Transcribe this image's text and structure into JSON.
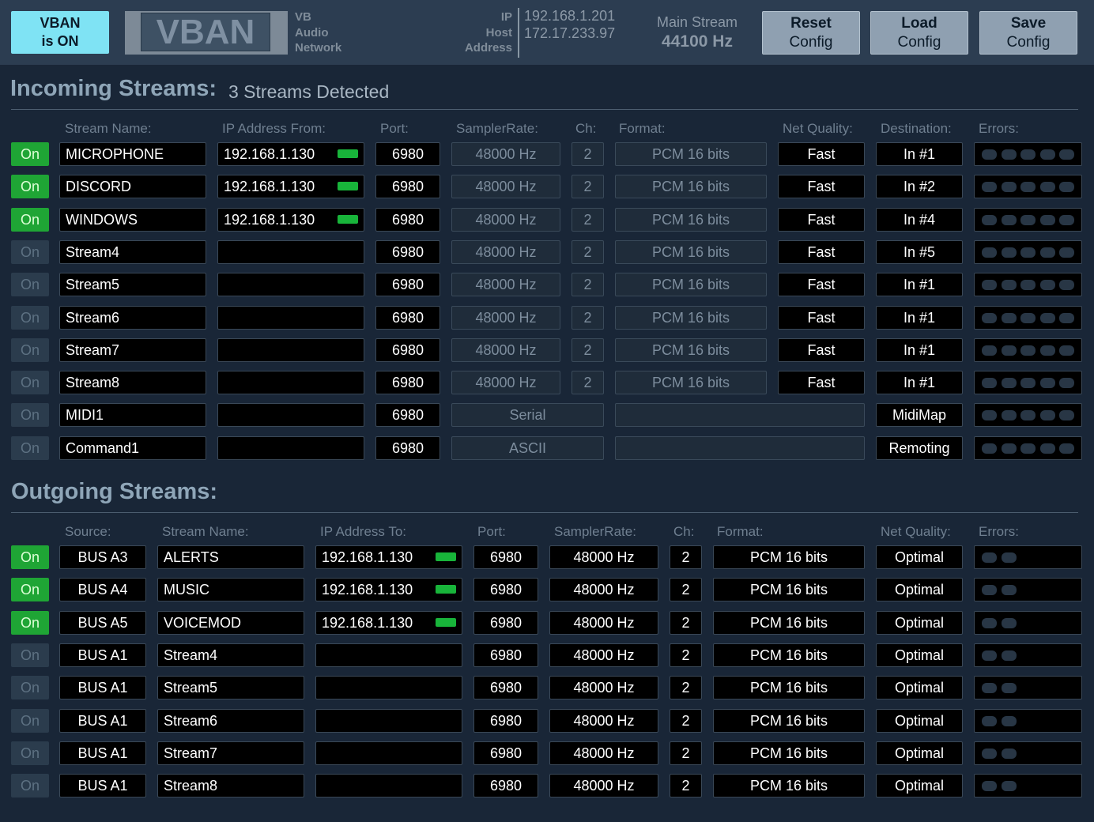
{
  "header": {
    "vban_status": [
      "VBAN",
      "is ON"
    ],
    "logo": "VBAN",
    "vb_lines": [
      "VB",
      "Audio",
      "Network"
    ],
    "ip_labels": [
      "IP",
      "Host",
      "Address"
    ],
    "ip_values": [
      "192.168.1.201",
      "172.17.233.97"
    ],
    "main_stream_label": "Main Stream",
    "main_stream_value": "44100 Hz",
    "buttons": [
      {
        "line1": "Reset",
        "line2": "Config"
      },
      {
        "line1": "Load",
        "line2": "Config"
      },
      {
        "line1": "Save",
        "line2": "Config"
      }
    ]
  },
  "incoming": {
    "title": "Incoming Streams:",
    "subtitle": "3 Streams Detected",
    "columns": [
      "Stream Name:",
      "IP Address From:",
      "Port:",
      "SamplerRate:",
      "Ch:",
      "Format:",
      "Net Quality:",
      "Destination:",
      "Errors:"
    ],
    "rows": [
      {
        "on": "On",
        "active": true,
        "name": "MICROPHONE",
        "ip": "192.168.1.130",
        "led": true,
        "port": "6980",
        "rate": "48000 Hz",
        "ch": "2",
        "format": "PCM 16 bits",
        "quality": "Fast",
        "dest": "In #1"
      },
      {
        "on": "On",
        "active": true,
        "name": "DISCORD",
        "ip": "192.168.1.130",
        "led": true,
        "port": "6980",
        "rate": "48000 Hz",
        "ch": "2",
        "format": "PCM 16 bits",
        "quality": "Fast",
        "dest": "In #2"
      },
      {
        "on": "On",
        "active": true,
        "name": "WINDOWS",
        "ip": "192.168.1.130",
        "led": true,
        "port": "6980",
        "rate": "48000 Hz",
        "ch": "2",
        "format": "PCM 16 bits",
        "quality": "Fast",
        "dest": "In #4"
      },
      {
        "on": "On",
        "active": false,
        "name": "Stream4",
        "ip": "",
        "led": false,
        "port": "6980",
        "rate": "48000 Hz",
        "ch": "2",
        "format": "PCM 16 bits",
        "quality": "Fast",
        "dest": "In #5"
      },
      {
        "on": "On",
        "active": false,
        "name": "Stream5",
        "ip": "",
        "led": false,
        "port": "6980",
        "rate": "48000 Hz",
        "ch": "2",
        "format": "PCM 16 bits",
        "quality": "Fast",
        "dest": "In #1"
      },
      {
        "on": "On",
        "active": false,
        "name": "Stream6",
        "ip": "",
        "led": false,
        "port": "6980",
        "rate": "48000 Hz",
        "ch": "2",
        "format": "PCM 16 bits",
        "quality": "Fast",
        "dest": "In #1"
      },
      {
        "on": "On",
        "active": false,
        "name": "Stream7",
        "ip": "",
        "led": false,
        "port": "6980",
        "rate": "48000 Hz",
        "ch": "2",
        "format": "PCM 16 bits",
        "quality": "Fast",
        "dest": "In #1"
      },
      {
        "on": "On",
        "active": false,
        "name": "Stream8",
        "ip": "",
        "led": false,
        "port": "6980",
        "rate": "48000 Hz",
        "ch": "2",
        "format": "PCM 16 bits",
        "quality": "Fast",
        "dest": "In #1"
      },
      {
        "on": "On",
        "active": false,
        "name": "MIDI1",
        "ip": "",
        "led": false,
        "port": "6980",
        "mode": "Serial",
        "dest": "MidiMap"
      },
      {
        "on": "On",
        "active": false,
        "name": "Command1",
        "ip": "",
        "led": false,
        "port": "6980",
        "mode": "ASCII",
        "dest": "Remoting"
      }
    ]
  },
  "outgoing": {
    "title": "Outgoing Streams:",
    "columns": [
      "Source:",
      "Stream Name:",
      "IP Address To:",
      "Port:",
      "SamplerRate:",
      "Ch:",
      "Format:",
      "Net Quality:",
      "Errors:"
    ],
    "rows": [
      {
        "on": "On",
        "active": true,
        "source": "BUS A3",
        "name": "ALERTS",
        "ip": "192.168.1.130",
        "led": true,
        "port": "6980",
        "rate": "48000 Hz",
        "ch": "2",
        "format": "PCM 16 bits",
        "quality": "Optimal"
      },
      {
        "on": "On",
        "active": true,
        "source": "BUS A4",
        "name": "MUSIC",
        "ip": "192.168.1.130",
        "led": true,
        "port": "6980",
        "rate": "48000 Hz",
        "ch": "2",
        "format": "PCM 16 bits",
        "quality": "Optimal"
      },
      {
        "on": "On",
        "active": true,
        "source": "BUS A5",
        "name": "VOICEMOD",
        "ip": "192.168.1.130",
        "led": true,
        "port": "6980",
        "rate": "48000 Hz",
        "ch": "2",
        "format": "PCM 16 bits",
        "quality": "Optimal"
      },
      {
        "on": "On",
        "active": false,
        "source": "BUS A1",
        "name": "Stream4",
        "ip": "",
        "led": false,
        "port": "6980",
        "rate": "48000 Hz",
        "ch": "2",
        "format": "PCM 16 bits",
        "quality": "Optimal"
      },
      {
        "on": "On",
        "active": false,
        "source": "BUS A1",
        "name": "Stream5",
        "ip": "",
        "led": false,
        "port": "6980",
        "rate": "48000 Hz",
        "ch": "2",
        "format": "PCM 16 bits",
        "quality": "Optimal"
      },
      {
        "on": "On",
        "active": false,
        "source": "BUS A1",
        "name": "Stream6",
        "ip": "",
        "led": false,
        "port": "6980",
        "rate": "48000 Hz",
        "ch": "2",
        "format": "PCM 16 bits",
        "quality": "Optimal"
      },
      {
        "on": "On",
        "active": false,
        "source": "BUS A1",
        "name": "Stream7",
        "ip": "",
        "led": false,
        "port": "6980",
        "rate": "48000 Hz",
        "ch": "2",
        "format": "PCM 16 bits",
        "quality": "Optimal"
      },
      {
        "on": "On",
        "active": false,
        "source": "BUS A1",
        "name": "Stream8",
        "ip": "",
        "led": false,
        "port": "6980",
        "rate": "48000 Hz",
        "ch": "2",
        "format": "PCM 16 bits",
        "quality": "Optimal"
      }
    ]
  }
}
